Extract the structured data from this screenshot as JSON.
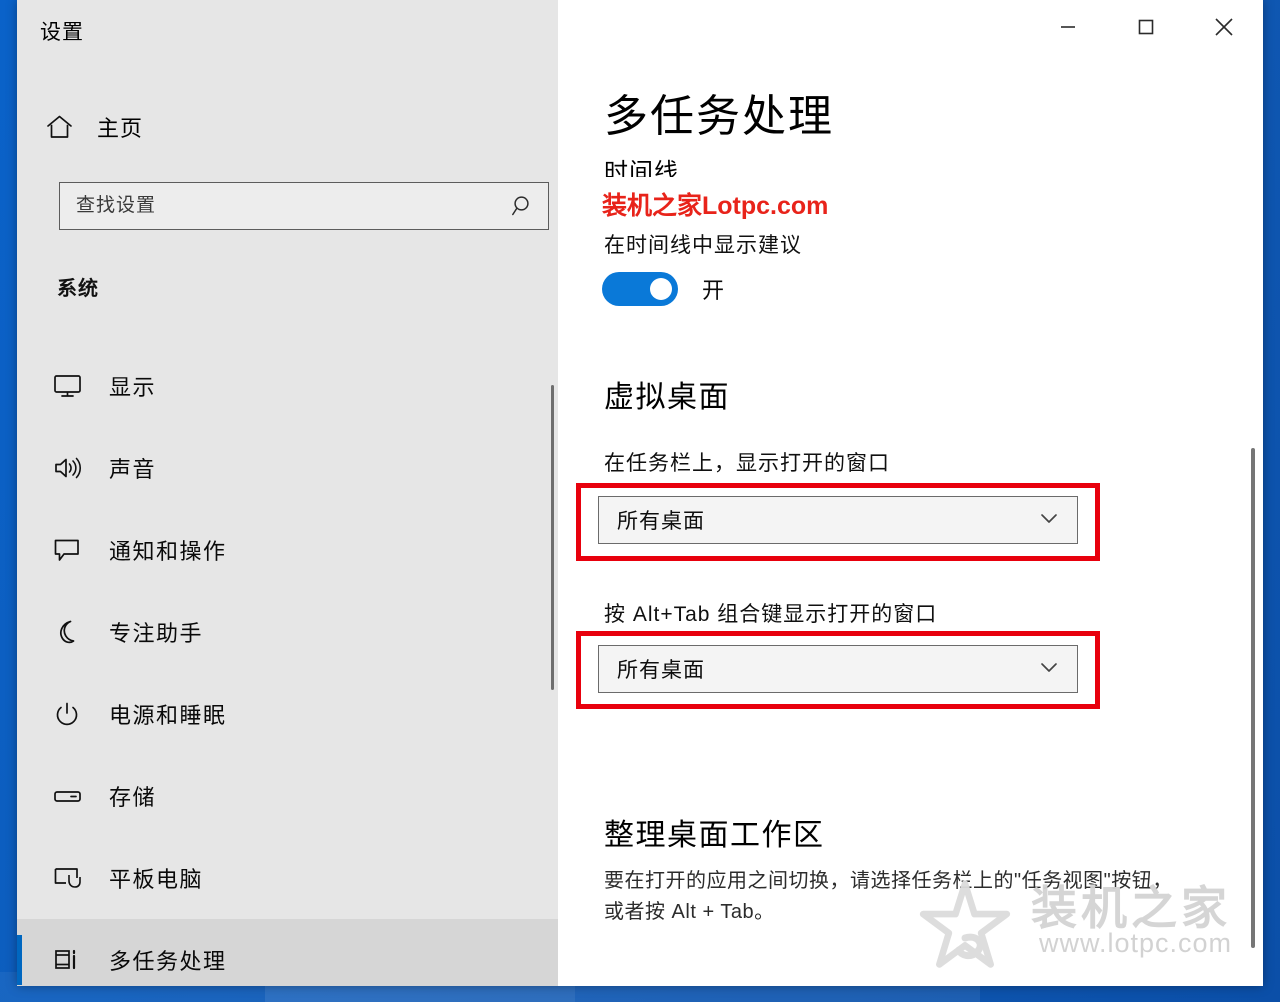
{
  "window": {
    "app_title": "设置",
    "controls": [
      {
        "name": "minimize",
        "glyph": "minimize-icon"
      },
      {
        "name": "maximize",
        "glyph": "maximize-icon"
      },
      {
        "name": "close",
        "glyph": "close-icon"
      }
    ]
  },
  "sidebar": {
    "home_label": "主页",
    "home_icon": "home-icon",
    "search": {
      "placeholder": "查找设置",
      "value": "",
      "icon": "search-icon"
    },
    "group_title": "系统",
    "items": [
      {
        "label": "显示",
        "icon": "monitor-icon",
        "selected": false
      },
      {
        "label": "声音",
        "icon": "speaker-icon",
        "selected": false
      },
      {
        "label": "通知和操作",
        "icon": "chat-icon",
        "selected": false
      },
      {
        "label": "专注助手",
        "icon": "moon-icon",
        "selected": false
      },
      {
        "label": "电源和睡眠",
        "icon": "power-icon",
        "selected": false
      },
      {
        "label": "存储",
        "icon": "drive-icon",
        "selected": false
      },
      {
        "label": "平板电脑",
        "icon": "tablet-icon",
        "selected": false
      },
      {
        "label": "多任务处理",
        "icon": "multitask-icon",
        "selected": true
      }
    ]
  },
  "main": {
    "page_title": "多任务处理",
    "timeline": {
      "heading": "时间线",
      "sub_label": "在时间线中显示建议",
      "toggle_state": "开",
      "toggle_on": true
    },
    "virtual_desktops": {
      "heading": "虚拟桌面",
      "taskbar_label": "在任务栏上，显示打开的窗口",
      "taskbar_value": "所有桌面",
      "alttab_label": "按 Alt+Tab 组合键显示打开的窗口",
      "alttab_value": "所有桌面",
      "chevron_icon": "chevron-down-icon",
      "highlight_color": "#e8000d"
    },
    "workspace": {
      "heading": "整理桌面工作区",
      "description": "要在打开的应用之间切换，请选择任务栏上的\"任务视图\"按钮，或者按 Alt + Tab。"
    }
  },
  "watermarks": {
    "red_text": "装机之家Lotpc.com",
    "red_color": "#e8231a",
    "gray_cn": "装机之家",
    "gray_url": "www.lotpc.com",
    "gray_icon": "star-logo-icon"
  },
  "colors": {
    "accent": "#0a79d8",
    "sidebar_bg": "#e6e6e6",
    "desktop_bg": "#0d5dbd",
    "selection_bar": "#0067c0"
  }
}
